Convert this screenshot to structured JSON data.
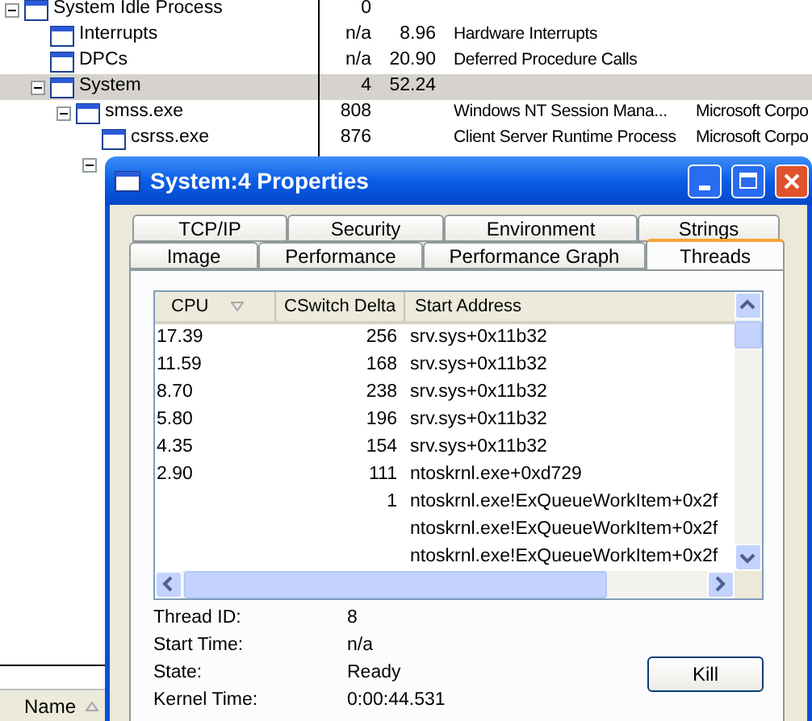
{
  "process_tree": [
    {
      "name": "System Idle Process",
      "pid": "0",
      "expanded": true,
      "selected": false,
      "children": [
        {
          "name": "Interrupts",
          "pid": "n/a",
          "cpu": "8.96",
          "description": "Hardware Interrupts",
          "selected": false
        },
        {
          "name": "DPCs",
          "pid": "n/a",
          "cpu": "20.90",
          "description": "Deferred Procedure Calls",
          "selected": false
        },
        {
          "name": "System",
          "pid": "4",
          "cpu": "52.24",
          "expanded": true,
          "selected": true,
          "children": [
            {
              "name": "smss.exe",
              "pid": "808",
              "description": "Windows NT Session Mana...",
              "company": "Microsoft Corpo",
              "expanded": true,
              "selected": false,
              "children": [
                {
                  "name": "csrss.exe",
                  "pid": "876",
                  "description": "Client Server Runtime Process",
                  "company": "Microsoft Corpo",
                  "selected": false
                },
                {
                  "expanded": true,
                  "selected": false
                }
              ]
            }
          ]
        }
      ]
    }
  ],
  "lower_pane": {
    "columns": [
      {
        "label": "Name",
        "sorted": true
      }
    ]
  },
  "dialog": {
    "title": "System:4 Properties",
    "tab_rows": [
      [
        {
          "label": "TCP/IP",
          "selected": false
        },
        {
          "label": "Security",
          "selected": false
        },
        {
          "label": "Environment",
          "selected": false
        },
        {
          "label": "Strings",
          "selected": false
        }
      ],
      [
        {
          "label": "Image",
          "selected": false
        },
        {
          "label": "Performance",
          "selected": false
        },
        {
          "label": "Performance Graph",
          "selected": false
        },
        {
          "label": "Threads",
          "selected": true
        }
      ]
    ],
    "threads": {
      "columns": [
        {
          "label": "CPU",
          "sorted": true
        },
        {
          "label": "CSwitch Delta"
        },
        {
          "label": "Start Address"
        }
      ],
      "rows": [
        {
          "cpu": "17.39",
          "cswitch": "256",
          "start": "srv.sys+0x11b32"
        },
        {
          "cpu": "11.59",
          "cswitch": "168",
          "start": "srv.sys+0x11b32"
        },
        {
          "cpu": "8.70",
          "cswitch": "238",
          "start": "srv.sys+0x11b32"
        },
        {
          "cpu": "5.80",
          "cswitch": "196",
          "start": "srv.sys+0x11b32"
        },
        {
          "cpu": "4.35",
          "cswitch": "154",
          "start": "srv.sys+0x11b32"
        },
        {
          "cpu": "2.90",
          "cswitch": "111",
          "start": "ntoskrnl.exe+0xd729"
        },
        {
          "cswitch": "1",
          "start": "ntoskrnl.exe!ExQueueWorkItem+0x2f"
        },
        {
          "start": "ntoskrnl.exe!ExQueueWorkItem+0x2f"
        },
        {
          "start": "ntoskrnl.exe!ExQueueWorkItem+0x2f"
        }
      ]
    },
    "details": [
      {
        "label": "Thread ID:",
        "value": "8"
      },
      {
        "label": "Start Time:",
        "value": "n/a"
      },
      {
        "label": "State:",
        "value": "Ready"
      },
      {
        "label": "Kernel Time:",
        "value": "0:00:44.531"
      }
    ],
    "buttons": [
      {
        "label": "Kill"
      }
    ]
  }
}
